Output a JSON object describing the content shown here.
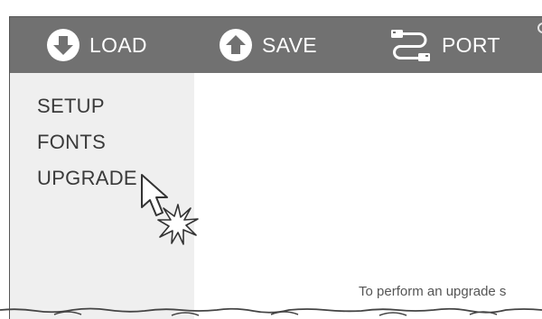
{
  "toolbar": {
    "load_label": "LOAD",
    "save_label": "SAVE",
    "port_label": "PORT",
    "load_icon": "download-circle-icon",
    "save_icon": "upload-circle-icon",
    "port_icon": "usb-cable-icon"
  },
  "menu": {
    "items": [
      {
        "label": "SETUP"
      },
      {
        "label": "FONTS"
      },
      {
        "label": "UPGRADE"
      }
    ]
  },
  "content": {
    "instruction_text": "To perform an upgrade s"
  },
  "colors": {
    "toolbar_bg": "#717171",
    "menu_bg": "#efefef",
    "text": "#3a3a3a"
  }
}
